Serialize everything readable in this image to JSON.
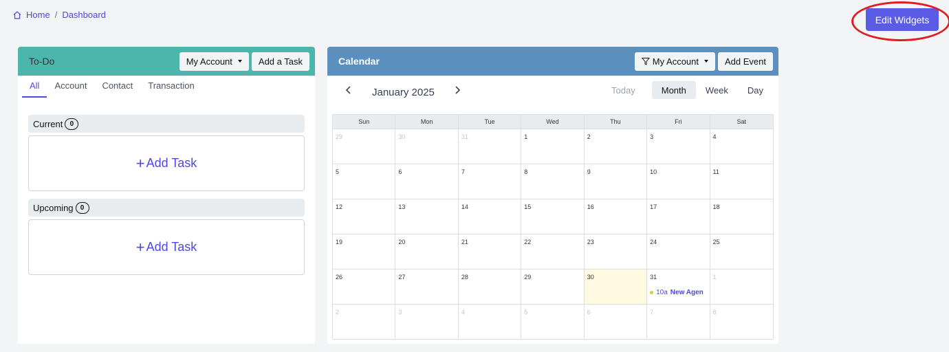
{
  "breadcrumb": {
    "home": "Home",
    "separator": "/",
    "current": "Dashboard"
  },
  "edit_widgets_label": "Edit Widgets",
  "todo": {
    "title": "To-Do",
    "account_dropdown": "My Account",
    "add_button": "Add a Task",
    "tabs": [
      "All",
      "Account",
      "Contact",
      "Transaction"
    ],
    "active_tab": "All",
    "sections": [
      {
        "label": "Current",
        "count": "0",
        "add_label": "Add Task"
      },
      {
        "label": "Upcoming",
        "count": "0",
        "add_label": "Add Task"
      }
    ]
  },
  "calendar": {
    "title": "Calendar",
    "account_dropdown": "My Account",
    "add_button": "Add Event",
    "month_label": "January 2025",
    "views": [
      "Today",
      "Month",
      "Week",
      "Day"
    ],
    "active_view": "Month",
    "days_of_week": [
      "Sun",
      "Mon",
      "Tue",
      "Wed",
      "Thu",
      "Fri",
      "Sat"
    ],
    "weeks": [
      [
        "29",
        "30",
        "31",
        "1",
        "2",
        "3",
        "4"
      ],
      [
        "5",
        "6",
        "7",
        "8",
        "9",
        "10",
        "11"
      ],
      [
        "12",
        "13",
        "14",
        "15",
        "16",
        "17",
        "18"
      ],
      [
        "19",
        "20",
        "21",
        "22",
        "23",
        "24",
        "25"
      ],
      [
        "26",
        "27",
        "28",
        "29",
        "30",
        "31",
        "1"
      ],
      [
        "2",
        "3",
        "4",
        "5",
        "6",
        "7",
        "8"
      ]
    ],
    "today_cell": "30",
    "event": {
      "time": "10a",
      "title": "New Agen"
    }
  },
  "colors": {
    "accent": "#4f46e5",
    "todo_header": "#4db6ac",
    "calendar_header": "#5b8fbe",
    "edit_button": "#5b5ce6",
    "highlight_ring": "#e11d24"
  }
}
